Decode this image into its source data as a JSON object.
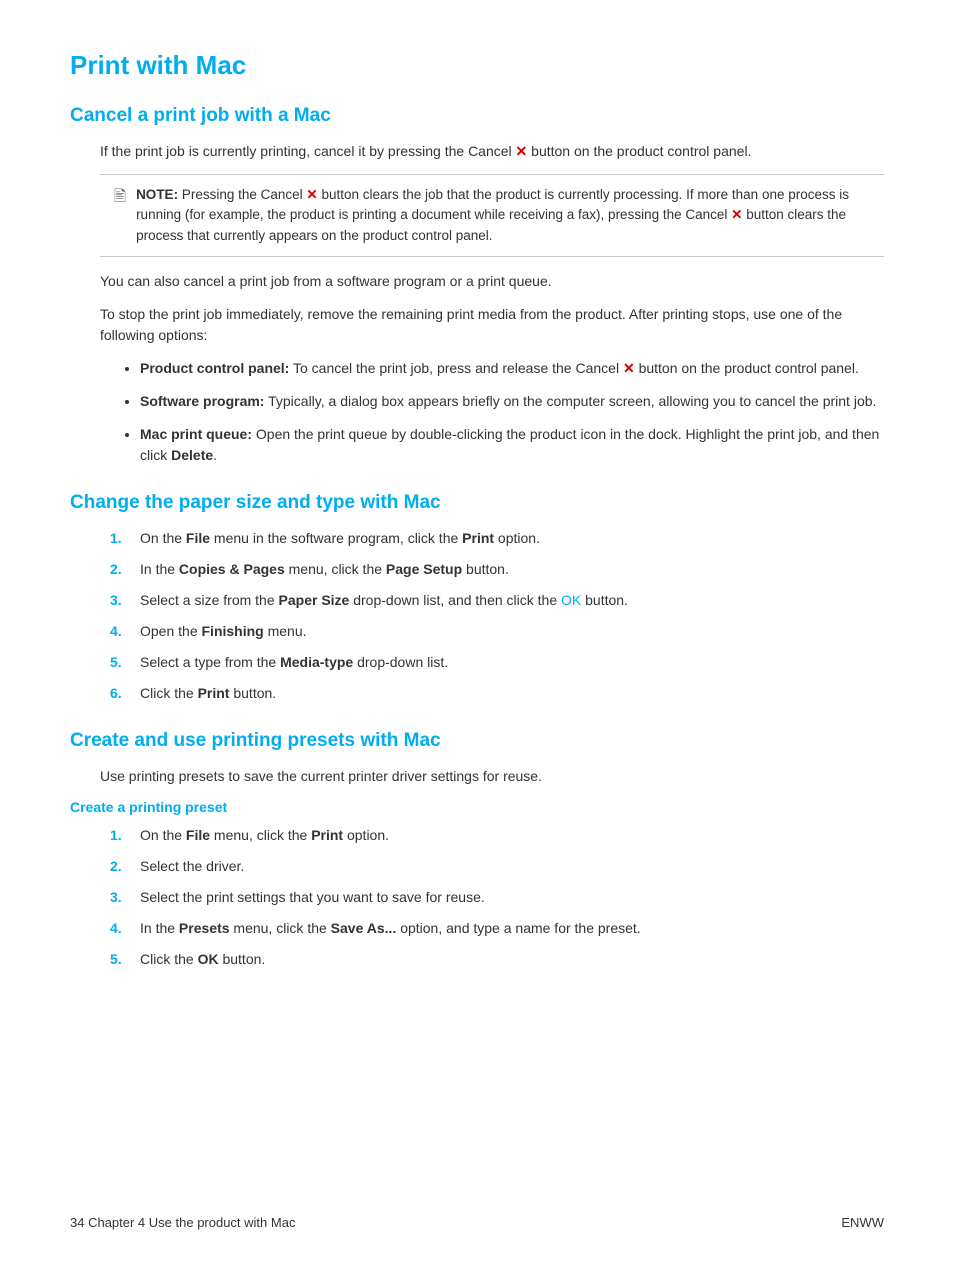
{
  "page": {
    "title": "Print with Mac",
    "footer_left": "34    Chapter 4   Use the product with Mac",
    "footer_right": "ENWW"
  },
  "sections": {
    "cancel_print": {
      "heading": "Cancel a print job with a Mac",
      "para1": "If the print job is currently printing, cancel it by pressing the Cancel  button on the product control panel.",
      "note_label": "NOTE:",
      "note_text": "Pressing the Cancel  button clears the job that the product is currently processing. If more than one process is running (for example, the product is printing a document while receiving a fax), pressing the Cancel  button clears the process that currently appears on the product control panel.",
      "para2": "You can also cancel a print job from a software program or a print queue.",
      "para3": "To stop the print job immediately, remove the remaining print media from the product. After printing stops, use one of the following options:",
      "bullets": [
        {
          "label": "Product control panel:",
          "text": " To cancel the print job, press and release the Cancel  button on the product control panel."
        },
        {
          "label": "Software program:",
          "text": " Typically, a dialog box appears briefly on the computer screen, allowing you to cancel the print job."
        },
        {
          "label": "Mac print queue:",
          "text": " Open the print queue by double-clicking the product icon in the dock. Highlight the print job, and then click "
        }
      ],
      "delete_label": "Delete"
    },
    "paper_size": {
      "heading": "Change the paper size and type with Mac",
      "steps": [
        {
          "text_before": "On the ",
          "bold": "File",
          "text_mid": " menu in the software program, click the ",
          "bold2": "Print",
          "text_after": " option."
        },
        {
          "text_before": "In the ",
          "bold": "Copies & Pages",
          "text_mid": " menu, click the ",
          "bold2": "Page Setup",
          "text_after": " button."
        },
        {
          "text_before": "Select a size from the ",
          "bold": "Paper Size",
          "text_mid": " drop-down list, and then click the ",
          "ok_link": "OK",
          "text_after": " button."
        },
        {
          "text_before": "Open the ",
          "bold": "Finishing",
          "text_after": " menu."
        },
        {
          "text_before": "Select a type from the ",
          "bold": "Media-type",
          "text_after": " drop-down list."
        },
        {
          "text_before": "Click the ",
          "bold": "Print",
          "text_after": " button."
        }
      ]
    },
    "printing_presets": {
      "heading": "Create and use printing presets with Mac",
      "intro": "Use printing presets to save the current printer driver settings for reuse.",
      "sub_heading": "Create a printing preset",
      "steps": [
        {
          "text_before": "On the ",
          "bold": "File",
          "text_mid": " menu, click the ",
          "bold2": "Print",
          "text_after": " option."
        },
        {
          "text_only": "Select the driver."
        },
        {
          "text_only": "Select the print settings that you want to save for reuse."
        },
        {
          "text_before": "In the ",
          "bold": "Presets",
          "text_mid": " menu, click the ",
          "bold2": "Save As...",
          "text_after": " option, and type a name for the preset."
        },
        {
          "text_before": "Click the ",
          "bold": "OK",
          "text_after": " button."
        }
      ]
    }
  }
}
